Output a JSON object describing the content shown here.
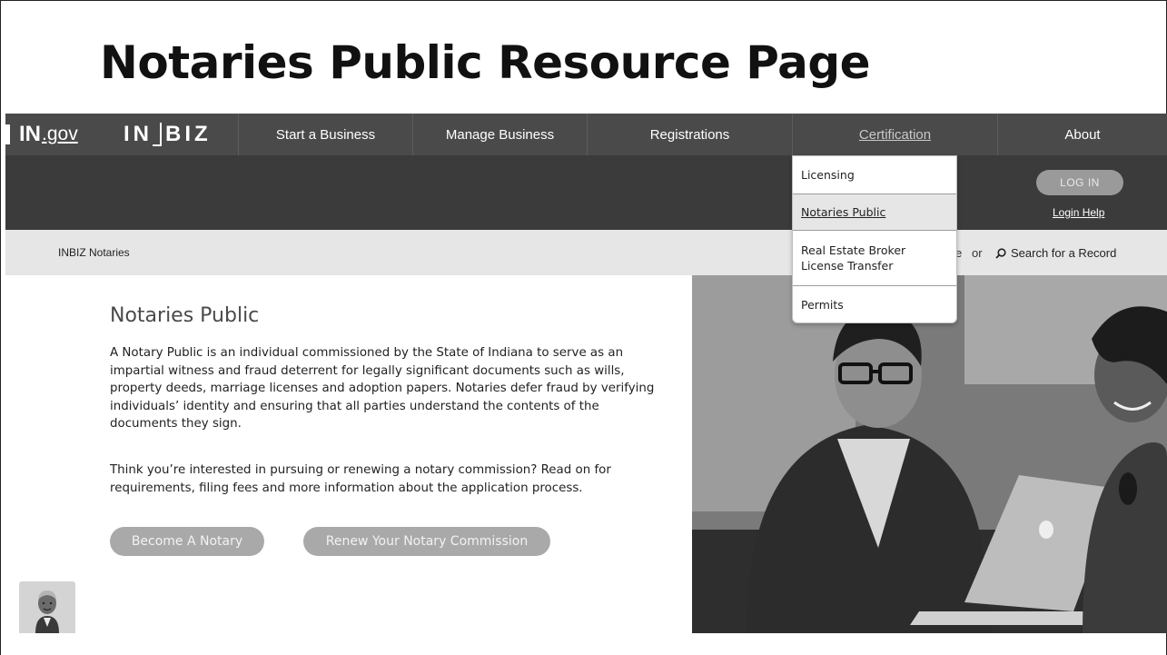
{
  "slide": {
    "title": "Notaries Public Resource Page"
  },
  "header": {
    "logo_ingov": {
      "in": "IN",
      "gov": ".gov"
    },
    "logo_inbiz": {
      "in": "IN",
      "biz": "BIZ"
    },
    "nav": [
      {
        "label": "Start a Business"
      },
      {
        "label": "Manage Business"
      },
      {
        "label": "Registrations"
      },
      {
        "label": "Certification"
      },
      {
        "label": "About"
      }
    ],
    "login_label": "LOG IN",
    "login_help": "Login Help"
  },
  "dropdown": {
    "items": [
      {
        "label": "Licensing"
      },
      {
        "label": "Notaries Public"
      },
      {
        "label": "Real Estate Broker License Transfer"
      },
      {
        "label": "Permits"
      }
    ]
  },
  "breadcrumb": {
    "label": "INBIZ Notaries"
  },
  "search": {
    "partial": "e",
    "or": "or",
    "label": "Search for a Record"
  },
  "main": {
    "title": "Notaries Public",
    "para1": "A Notary Public is an individual commissioned by the State of Indiana to serve as an impartial witness and fraud deterrent for legally significant documents such as wills, property deeds, marriage licenses and adoption papers. Notaries defer fraud by verifying individuals’ identity and ensuring that all parties understand the contents of the documents they sign.",
    "para2": "Think you’re interested in pursuing or renewing a notary commission? Read on for requirements, filing fees and more information about the application process.",
    "buttons": {
      "become": "Become A Notary",
      "renew": "Renew Your Notary Commission"
    }
  },
  "colors": {
    "nav_bg": "#4a4a4a",
    "band_bg": "#3b3b3b",
    "crumb_bg": "#e6e6e6",
    "pill_bg": "#a9a9a9"
  },
  "icons": {
    "search": "search-icon",
    "assistant": "assistant-avatar-icon"
  }
}
